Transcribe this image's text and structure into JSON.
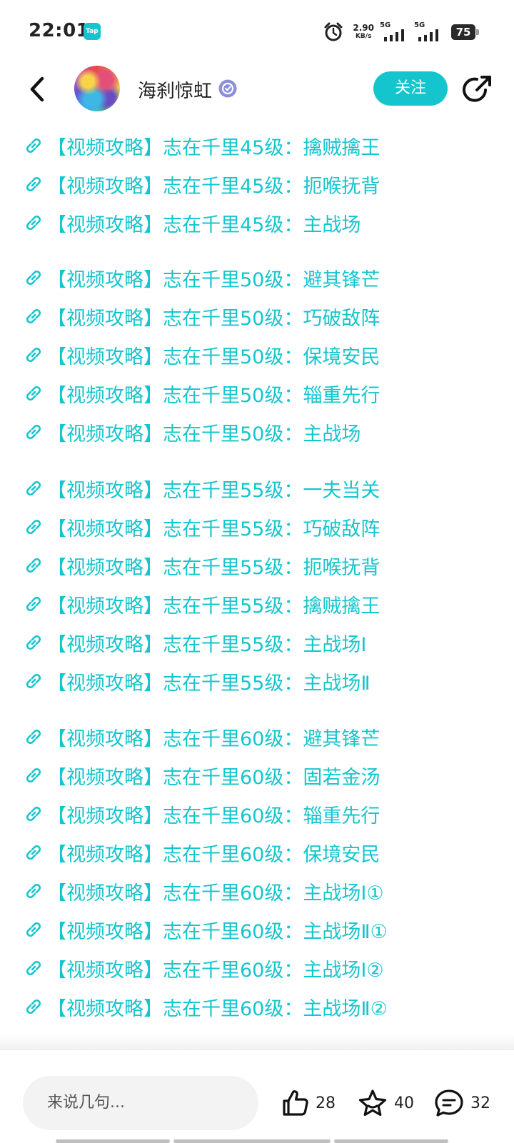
{
  "status_bar": {
    "time": "22:01",
    "app_badge": "Tap",
    "net_speed_value": "2.90",
    "net_speed_unit": "KB/s",
    "signal1_label": "5G",
    "signal2_label": "5G",
    "battery": "75"
  },
  "header": {
    "back_icon": "chevron-left-icon",
    "username": "海刹惊虹",
    "verified_icon": "verified-badge-icon",
    "follow_label": "关注",
    "share_icon": "share-icon"
  },
  "links": [
    "【视频攻略】志在千里45级：擒贼擒王",
    "【视频攻略】志在千里45级：扼喉抚背",
    "【视频攻略】志在千里45级：主战场",
    "【视频攻略】志在千里50级：避其锋芒",
    "【视频攻略】志在千里50级：巧破敌阵",
    "【视频攻略】志在千里50级：保境安民",
    "【视频攻略】志在千里50级：辎重先行",
    "【视频攻略】志在千里50级：主战场",
    "【视频攻略】志在千里55级：一夫当关",
    "【视频攻略】志在千里55级：巧破敌阵",
    "【视频攻略】志在千里55级：扼喉抚背",
    "【视频攻略】志在千里55级：擒贼擒王",
    "【视频攻略】志在千里55级：主战场Ⅰ",
    "【视频攻略】志在千里55级：主战场Ⅱ",
    "【视频攻略】志在千里60级：避其锋芒",
    "【视频攻略】志在千里60级：固若金汤",
    "【视频攻略】志在千里60级：辎重先行",
    "【视频攻略】志在千里60级：保境安民",
    "【视频攻略】志在千里60级：主战场Ⅰ①",
    "【视频攻略】志在千里60级：主战场Ⅱ①",
    "【视频攻略】志在千里60级：主战场Ⅰ②",
    "【视频攻略】志在千里60级：主战场Ⅱ②"
  ],
  "bottom_bar": {
    "comment_placeholder": "来说几句...",
    "like_icon": "thumbs-up-icon",
    "like_count": "28",
    "favorite_icon": "star-icon",
    "favorite_count": "40",
    "comment_icon": "comment-bubble-icon",
    "comment_count": "32"
  },
  "colors": {
    "accent": "#15c5ce",
    "text": "#1e1e1e",
    "input_bg": "#f3f3f3"
  }
}
